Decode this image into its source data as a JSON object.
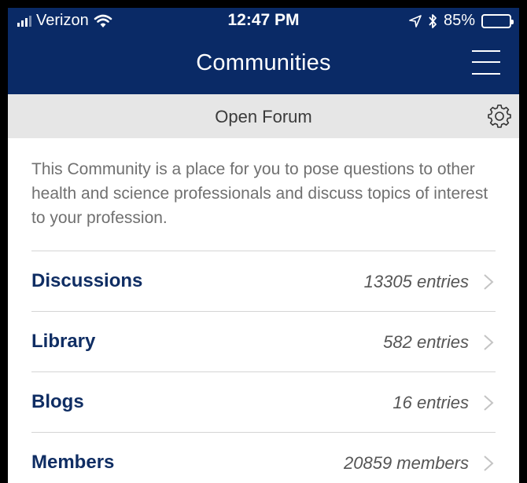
{
  "status_bar": {
    "carrier": "Verizon",
    "time": "12:47 PM",
    "battery": "85%",
    "battery_level": 0.85,
    "icons": [
      "signal-bars-icon",
      "wifi-icon",
      "location-arrow-icon",
      "bluetooth-icon",
      "battery-icon"
    ]
  },
  "nav": {
    "title": "Communities",
    "menu_icon": "hamburger-menu-icon"
  },
  "subheader": {
    "label": "Open Forum",
    "settings_icon": "gear-icon"
  },
  "description": "This Community is a place for you to pose questions to other health and science professionals and discuss topics of interest to your profession.",
  "sections": [
    {
      "name": "Discussions",
      "count": "13305 entries"
    },
    {
      "name": "Library",
      "count": "582 entries"
    },
    {
      "name": "Blogs",
      "count": "16 entries"
    },
    {
      "name": "Members",
      "count": "20859 members"
    }
  ],
  "colors": {
    "navy": "#0a2a66",
    "section_title": "#0f2d63",
    "subheader_bg": "#e6e6e6"
  }
}
